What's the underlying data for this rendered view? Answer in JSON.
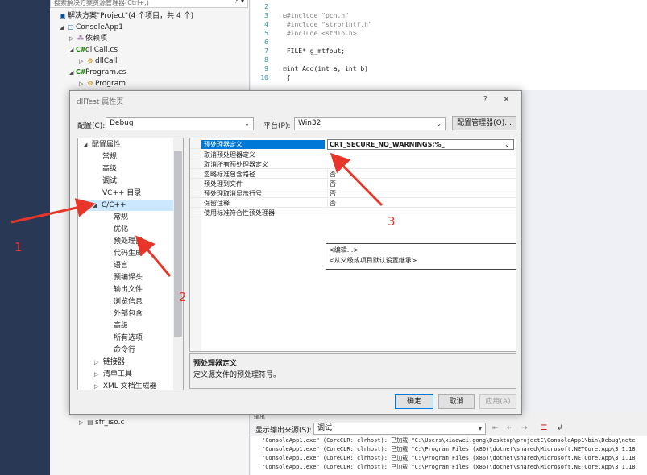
{
  "solution_explorer": {
    "search_placeholder": "搜索解决方案资源管理器(Ctrl+;)",
    "search_icon": "search-icon",
    "items": [
      {
        "label": "解决方案\"Project\"(4 个项目，共 4 个)",
        "icon": "solution-icon"
      },
      {
        "label": "ConsoleApp1",
        "icon": "csharp-project-icon"
      },
      {
        "label": "依赖项",
        "icon": "dependencies-icon"
      },
      {
        "label": "dllCall.cs",
        "icon": "csharp-file-icon"
      },
      {
        "label": "dllCall",
        "icon": "class-icon"
      },
      {
        "label": "Program.cs",
        "icon": "csharp-file-icon"
      },
      {
        "label": "Program",
        "icon": "class-icon"
      },
      {
        "label": "sfr_iso.c",
        "icon": "c-file-icon"
      }
    ]
  },
  "editor": {
    "lines": [
      {
        "num": "2",
        "text": ""
      },
      {
        "num": "3",
        "text": "#include \"pch.h\""
      },
      {
        "num": "4",
        "text": "#include \"strprintf.h\""
      },
      {
        "num": "5",
        "text": "#include <stdio.h>"
      },
      {
        "num": "6",
        "text": ""
      },
      {
        "num": "7",
        "text": "FILE* g_mtfout;"
      },
      {
        "num": "8",
        "text": ""
      },
      {
        "num": "9",
        "text": "int Add(int a, int b)"
      },
      {
        "num": "10",
        "text": "{"
      }
    ]
  },
  "dialog": {
    "title": "dllTest 属性页",
    "help_label": "?",
    "close_label": "✕",
    "config_label": "配置(C):",
    "config_value": "Debug",
    "platform_label": "平台(P):",
    "platform_value": "Win32",
    "config_manager_label": "配置管理器(O)...",
    "nav_items": [
      {
        "label": "配置属性",
        "expanded": true
      },
      {
        "label": "常规"
      },
      {
        "label": "高级"
      },
      {
        "label": "调试"
      },
      {
        "label": "VC++ 目录"
      },
      {
        "label": "C/C++",
        "expanded": true,
        "selected": true
      },
      {
        "label": "常规"
      },
      {
        "label": "优化"
      },
      {
        "label": "预处理器"
      },
      {
        "label": "代码生成"
      },
      {
        "label": "语言"
      },
      {
        "label": "预编译头"
      },
      {
        "label": "输出文件"
      },
      {
        "label": "浏览信息"
      },
      {
        "label": "外部包含"
      },
      {
        "label": "高级"
      },
      {
        "label": "所有选项"
      },
      {
        "label": "命令行"
      },
      {
        "label": "链接器",
        "collapsed": true
      },
      {
        "label": "清单工具",
        "collapsed": true
      },
      {
        "label": "XML 文档生成器",
        "collapsed": true
      }
    ],
    "properties": [
      {
        "name": "预处理器定义",
        "value": "_CRT_SECURE_NO_WARNINGS;%(PreprocessorDefinitions)",
        "selected": true
      },
      {
        "name": "取消预处理器定义",
        "value": ""
      },
      {
        "name": "取消所有预处理器定义",
        "value": ""
      },
      {
        "name": "忽略标准包含路径",
        "value": "否"
      },
      {
        "name": "预处理到文件",
        "value": "否"
      },
      {
        "name": "预处理取消显示行号",
        "value": "否"
      },
      {
        "name": "保留注释",
        "value": "否"
      },
      {
        "name": "使用标准符合性预处理器",
        "value": ""
      }
    ],
    "popup_options": [
      "<编辑...>",
      "<从父级或项目默认设置继承>"
    ],
    "desc_title": "预处理器定义",
    "desc_text": "定义源文件的预处理符号。",
    "ok_label": "确定",
    "cancel_label": "取消",
    "apply_label": "应用(A)"
  },
  "output": {
    "title": "输出",
    "source_label": "显示输出来源(S):",
    "source_value": "调试",
    "lines": [
      "\"ConsoleApp1.exe\" (CoreCLR: clrhost): 已加载 \"C:\\Users\\xiaowei.gong\\Desktop\\projectC\\ConsoleApp1\\bin\\Debug\\netc",
      "\"ConsoleApp1.exe\" (CoreCLR: clrhost): 已加载 \"C:\\Program Files (x86)\\dotnet\\shared\\Microsoft.NETCore.App\\3.1.18",
      "\"ConsoleApp1.exe\" (CoreCLR: clrhost): 已加载 \"C:\\Program Files (x86)\\dotnet\\shared\\Microsoft.NETCore.App\\3.1.18",
      "\"ConsoleApp1.exe\" (CoreCLR: clrhost): 已加载 \"C:\\Program Files (x86)\\dotnet\\shared\\Microsoft.NETCore.App\\3.1.18"
    ]
  },
  "annotations": {
    "labels": [
      "1",
      "2",
      "3"
    ],
    "color": "#e8352a"
  }
}
